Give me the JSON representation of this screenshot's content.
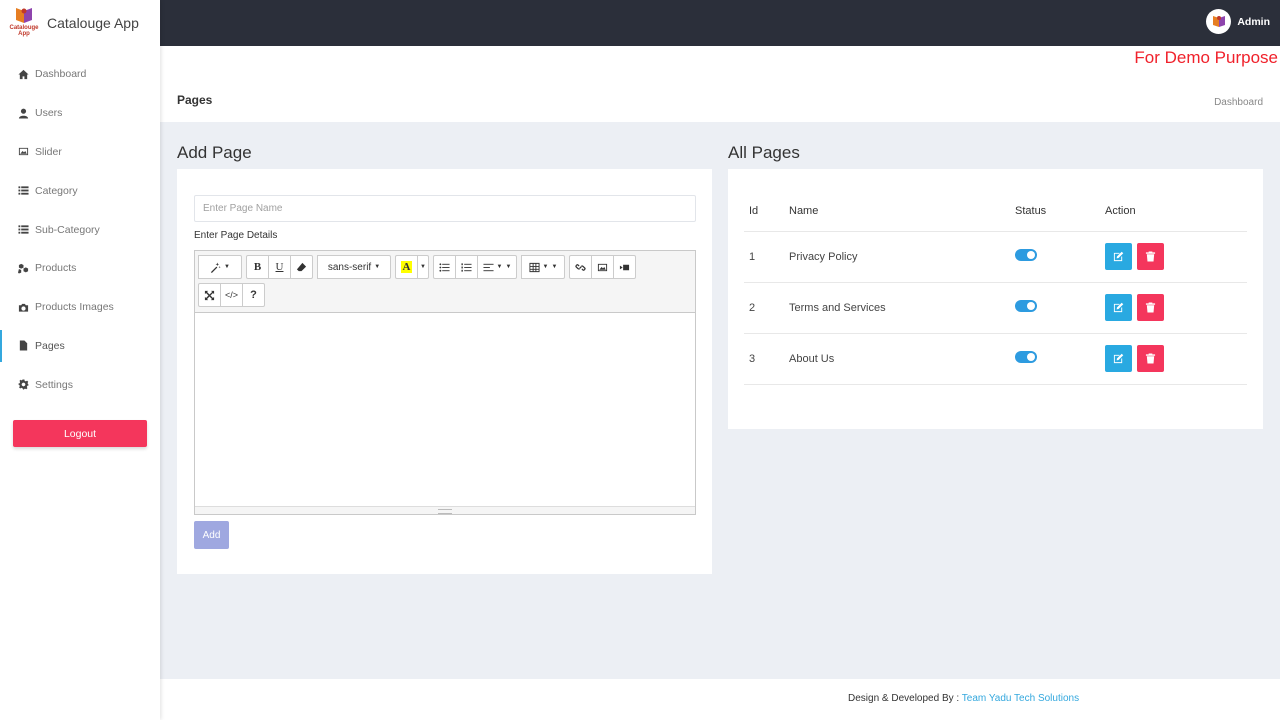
{
  "app": {
    "name": "Catalouge App",
    "logo_text": "Catalouge App"
  },
  "sidebar": {
    "items": [
      {
        "label": "Dashboard",
        "icon": "home-icon"
      },
      {
        "label": "Users",
        "icon": "user-icon"
      },
      {
        "label": "Slider",
        "icon": "image-icon"
      },
      {
        "label": "Category",
        "icon": "list-icon"
      },
      {
        "label": "Sub-Category",
        "icon": "list-icon"
      },
      {
        "label": "Products",
        "icon": "cubes-icon"
      },
      {
        "label": "Products Images",
        "icon": "camera-icon"
      },
      {
        "label": "Pages",
        "icon": "file-icon",
        "active": true
      },
      {
        "label": "Settings",
        "icon": "gear-icon"
      }
    ],
    "logout_label": "Logout"
  },
  "topbar": {
    "user_name": "Admin"
  },
  "demo_notice": "For Demo Purpose",
  "page_header": {
    "title": "Pages",
    "breadcrumb": "Dashboard"
  },
  "add_page": {
    "title": "Add Page",
    "name_placeholder": "Enter Page Name",
    "details_label": "Enter Page Details",
    "font_name": "sans-serif",
    "add_label": "Add"
  },
  "all_pages": {
    "title": "All Pages",
    "columns": [
      "Id",
      "Name",
      "Status",
      "Action"
    ],
    "rows": [
      {
        "id": "1",
        "name": "Privacy Policy",
        "status_on": true
      },
      {
        "id": "2",
        "name": "Terms and Services",
        "status_on": true
      },
      {
        "id": "3",
        "name": "About Us",
        "status_on": true
      }
    ]
  },
  "footer": {
    "prefix": "Design & Developed By :",
    "link": "Team Yadu Tech Solutions"
  },
  "colors": {
    "accent": "#34a8de",
    "danger": "#f4365c",
    "topbar": "#2b2f3a",
    "demo": "#f0212b",
    "add_button": "#9fa8e0"
  }
}
